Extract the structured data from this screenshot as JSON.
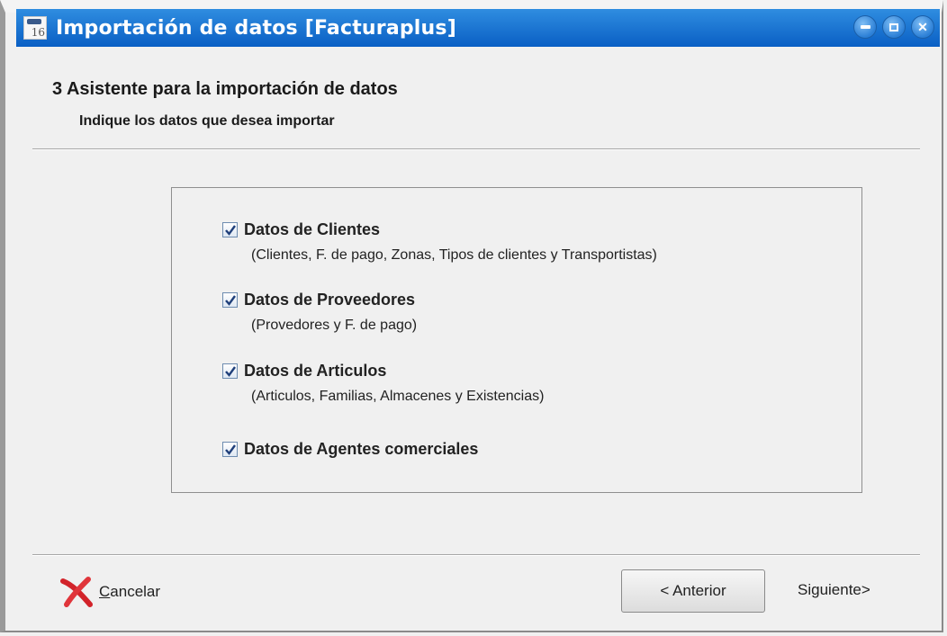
{
  "window": {
    "title": "Importación de datos [Facturaplus]",
    "app_icon_number": "16",
    "titlebar_color": "#0a6ad0"
  },
  "header": {
    "title": "3 Asistente para la importación de datos",
    "subtitle": "Indique los datos que desea importar"
  },
  "options": [
    {
      "label": "Datos de Clientes",
      "description": "(Clientes, F. de pago, Zonas, Tipos de clientes  y Transportistas)",
      "checked": true
    },
    {
      "label": "Datos de Proveedores",
      "description": "(Provedores y F. de pago)",
      "checked": true
    },
    {
      "label": "Datos de Articulos",
      "description": "(Articulos, Familias, Almacenes y Existencias)",
      "checked": true
    },
    {
      "label": "Datos de Agentes comerciales",
      "description": "",
      "checked": true
    }
  ],
  "footer": {
    "cancel_label": "Cancelar",
    "cancel_icon": "red-x-icon",
    "back_label": "< Anterior",
    "next_label": "Siguiente>"
  }
}
